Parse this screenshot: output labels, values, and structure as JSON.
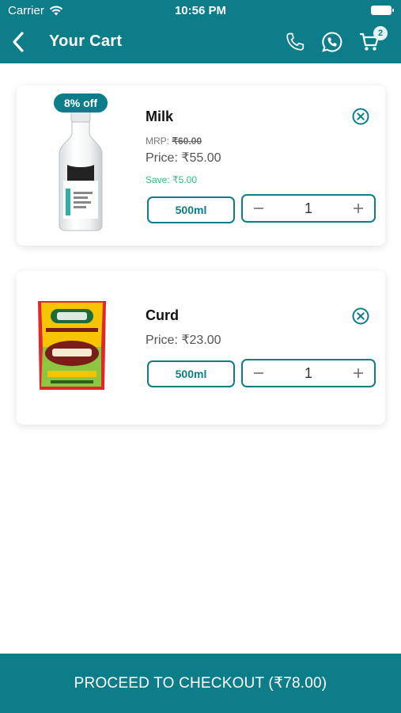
{
  "status_bar": {
    "carrier": "Carrier",
    "time": "10:56 PM"
  },
  "header": {
    "title": "Your Cart",
    "cart_count": "2"
  },
  "icons": {
    "back": "chevron-left-icon",
    "phone": "phone-icon",
    "whatsapp": "whatsapp-icon",
    "cart": "cart-icon",
    "remove": "close-circle-icon"
  },
  "colors": {
    "primary": "#0d7d8a",
    "save_green": "#2ec27e"
  },
  "cart_items": [
    {
      "name": "Milk",
      "discount_badge": "8% off",
      "mrp_label": "MRP: ",
      "mrp_value": "₹60.00",
      "price": "Price: ₹55.00",
      "save": "Save: ₹5.00",
      "size": "500ml",
      "quantity": "1"
    },
    {
      "name": "Curd",
      "price": "Price: ₹23.00",
      "size": "500ml",
      "quantity": "1"
    }
  ],
  "checkout": {
    "label": "PROCEED TO CHECKOUT (₹78.00)"
  }
}
